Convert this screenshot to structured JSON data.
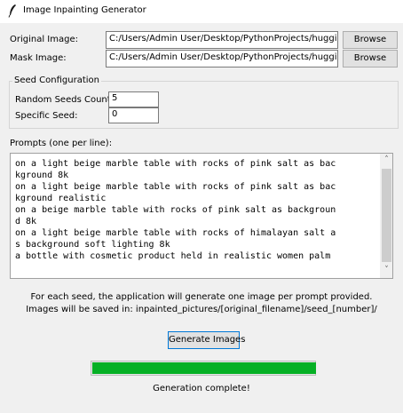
{
  "window": {
    "title": "Image Inpainting Generator",
    "icon": "feather-icon"
  },
  "files": {
    "original_label": "Original Image:",
    "original_value": "C:/Users/Admin User/Desktop/PythonProjects/hugginFa",
    "mask_label": "Mask Image:",
    "mask_value": "C:/Users/Admin User/Desktop/PythonProjects/hugginFa",
    "browse_label": "Browse"
  },
  "seed": {
    "group_title": "Seed Configuration",
    "random_label": "Random Seeds Count:",
    "random_value": "5",
    "specific_label": "Specific Seed:",
    "specific_value": "0"
  },
  "prompts": {
    "label": "Prompts (one per line):",
    "lines": [
      "on a light beige marble table with rocks of pink salt as bac",
      "kground 8k",
      "on a light beige marble table with rocks of pink salt as bac",
      "kground realistic",
      "on a beige marble table with rocks of pink salt as backgroun",
      "d 8k",
      "on a light beige marble table with rocks of himalayan salt a",
      "s background soft lighting 8k",
      "a bottle with cosmetic product held in realistic women palm"
    ]
  },
  "info": {
    "line1": "For each seed, the application will generate one image per prompt provided.",
    "line2": "Images will be saved in: inpainted_pictures/[original_filename]/seed_[number]/"
  },
  "actions": {
    "generate_label": "Generate Images"
  },
  "progress": {
    "value": 1.0,
    "color": "#06b025"
  },
  "status": {
    "text": "Generation complete!"
  }
}
